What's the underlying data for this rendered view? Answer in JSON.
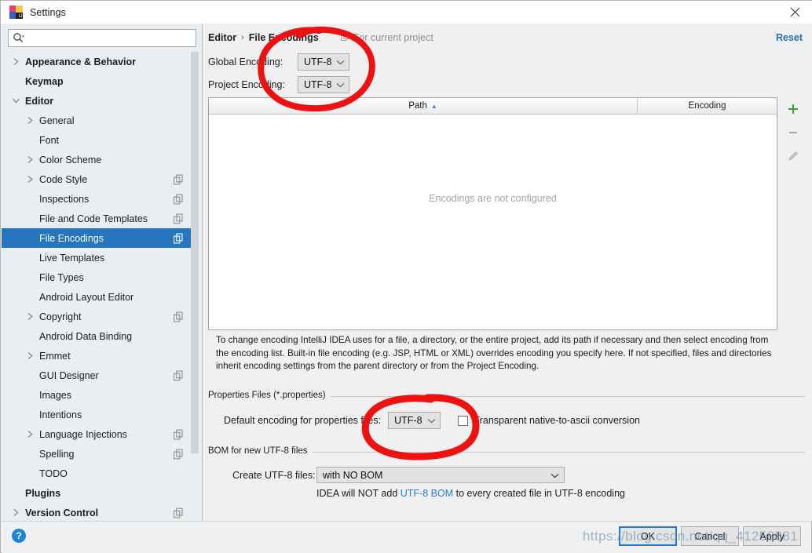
{
  "window": {
    "title": "Settings",
    "app_icon": "intellij-idea-logo",
    "close_icon": "close-icon"
  },
  "sidebar": {
    "search": {
      "placeholder": "",
      "value": "",
      "icon": "search-icon"
    },
    "items": [
      {
        "label": "Appearance & Behavior",
        "level": 0,
        "arrow": "collapsed",
        "bold": true,
        "copy": false,
        "selected": false
      },
      {
        "label": "Keymap",
        "level": 0,
        "arrow": "none",
        "bold": true,
        "copy": false,
        "selected": false
      },
      {
        "label": "Editor",
        "level": 0,
        "arrow": "expanded",
        "bold": true,
        "copy": false,
        "selected": false
      },
      {
        "label": "General",
        "level": 1,
        "arrow": "collapsed",
        "bold": false,
        "copy": false,
        "selected": false
      },
      {
        "label": "Font",
        "level": 1,
        "arrow": "none",
        "bold": false,
        "copy": false,
        "selected": false
      },
      {
        "label": "Color Scheme",
        "level": 1,
        "arrow": "collapsed",
        "bold": false,
        "copy": false,
        "selected": false
      },
      {
        "label": "Code Style",
        "level": 1,
        "arrow": "collapsed",
        "bold": false,
        "copy": true,
        "selected": false
      },
      {
        "label": "Inspections",
        "level": 1,
        "arrow": "none",
        "bold": false,
        "copy": true,
        "selected": false
      },
      {
        "label": "File and Code Templates",
        "level": 1,
        "arrow": "none",
        "bold": false,
        "copy": true,
        "selected": false
      },
      {
        "label": "File Encodings",
        "level": 1,
        "arrow": "none",
        "bold": false,
        "copy": true,
        "selected": true
      },
      {
        "label": "Live Templates",
        "level": 1,
        "arrow": "none",
        "bold": false,
        "copy": false,
        "selected": false
      },
      {
        "label": "File Types",
        "level": 1,
        "arrow": "none",
        "bold": false,
        "copy": false,
        "selected": false
      },
      {
        "label": "Android Layout Editor",
        "level": 1,
        "arrow": "none",
        "bold": false,
        "copy": false,
        "selected": false
      },
      {
        "label": "Copyright",
        "level": 1,
        "arrow": "collapsed",
        "bold": false,
        "copy": true,
        "selected": false
      },
      {
        "label": "Android Data Binding",
        "level": 1,
        "arrow": "none",
        "bold": false,
        "copy": false,
        "selected": false
      },
      {
        "label": "Emmet",
        "level": 1,
        "arrow": "collapsed",
        "bold": false,
        "copy": false,
        "selected": false
      },
      {
        "label": "GUI Designer",
        "level": 1,
        "arrow": "none",
        "bold": false,
        "copy": true,
        "selected": false
      },
      {
        "label": "Images",
        "level": 1,
        "arrow": "none",
        "bold": false,
        "copy": false,
        "selected": false
      },
      {
        "label": "Intentions",
        "level": 1,
        "arrow": "none",
        "bold": false,
        "copy": false,
        "selected": false
      },
      {
        "label": "Language Injections",
        "level": 1,
        "arrow": "collapsed",
        "bold": false,
        "copy": true,
        "selected": false
      },
      {
        "label": "Spelling",
        "level": 1,
        "arrow": "none",
        "bold": false,
        "copy": true,
        "selected": false
      },
      {
        "label": "TODO",
        "level": 1,
        "arrow": "none",
        "bold": false,
        "copy": false,
        "selected": false
      },
      {
        "label": "Plugins",
        "level": 0,
        "arrow": "none",
        "bold": true,
        "copy": false,
        "selected": false
      },
      {
        "label": "Version Control",
        "level": 0,
        "arrow": "collapsed",
        "bold": true,
        "copy": true,
        "selected": false
      }
    ]
  },
  "main": {
    "breadcrumb": {
      "parent": "Editor",
      "separator": "›",
      "current": "File Encodings"
    },
    "scope_note": {
      "text": "For current project",
      "icon": "copy-icon"
    },
    "reset_label": "Reset",
    "global_encoding": {
      "label": "Global Encoding:",
      "value": "UTF-8"
    },
    "project_encoding": {
      "label": "Project Encoding:",
      "value": "UTF-8"
    },
    "table": {
      "columns": [
        "Path",
        "Encoding"
      ],
      "sort_column": "Path",
      "sort_direction": "ascending",
      "rows": [],
      "empty_text": "Encodings are not configured",
      "tools": [
        {
          "name": "add-button",
          "glyph": "+",
          "color": "#3aa03a"
        },
        {
          "name": "remove-button",
          "glyph": "−",
          "color": "#9a9a9a"
        },
        {
          "name": "edit-button",
          "glyph": "pencil",
          "color": "#b0b0b0"
        }
      ]
    },
    "description": "To change encoding IntelliJ IDEA uses for a file, a directory, or the entire project, add its path if necessary and then select encoding from the encoding list. Built-in file encoding (e.g. JSP, HTML or XML) overrides encoding you specify here. If not specified, files and directories inherit encoding settings from the parent directory or from the Project Encoding.",
    "properties_group": {
      "title": "Properties Files (*.properties)",
      "default_encoding_label": "Default encoding for properties files:",
      "default_encoding_value": "UTF-8",
      "transparent_checkbox_label": "Transparent native-to-ascii conversion",
      "transparent_checked": false
    },
    "bom_group": {
      "title": "BOM for new UTF-8 files",
      "create_label": "Create UTF-8 files:",
      "create_value": "with NO BOM",
      "note_prefix": "IDEA will NOT add ",
      "note_link": "UTF-8 BOM",
      "note_suffix": " to every created file in UTF-8 encoding"
    }
  },
  "footer": {
    "help_glyph": "?",
    "ok_label": "OK",
    "cancel_label": "Cancel",
    "apply_label": "Apply"
  },
  "annotations": {
    "watermark": "https://blog.csdn.net/qq_41258881",
    "ink_color": "#ee1111",
    "shapes": [
      {
        "name": "circle-around-encoding-dropdowns",
        "type": "ellipse"
      },
      {
        "name": "circle-around-properties-encoding",
        "type": "ellipse"
      }
    ]
  }
}
